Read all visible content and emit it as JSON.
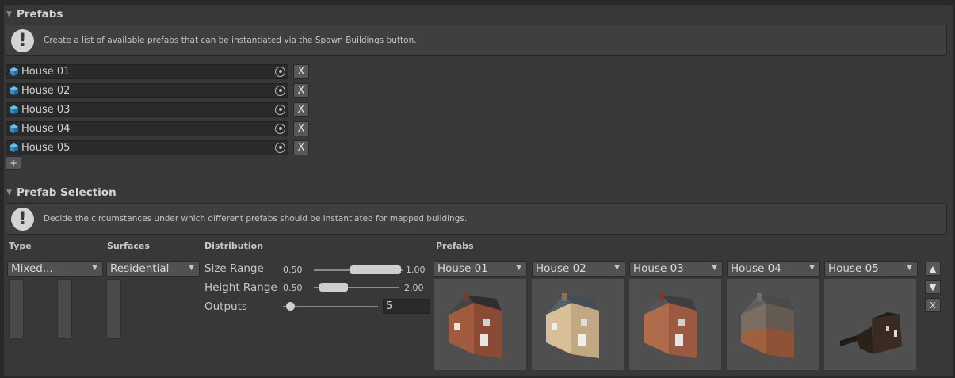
{
  "prefabs_section": {
    "title": "Prefabs",
    "help_text": "Create a list of available prefabs that can be instantiated via the Spawn Buildings button.",
    "items": [
      {
        "label": "House 01",
        "remove": "X"
      },
      {
        "label": "House 02",
        "remove": "X"
      },
      {
        "label": "House 03",
        "remove": "X"
      },
      {
        "label": "House 04",
        "remove": "X"
      },
      {
        "label": "House 05",
        "remove": "X"
      }
    ],
    "add_label": "+"
  },
  "selection_section": {
    "title": "Prefab Selection",
    "help_text": "Decide the circumstances under which different prefabs should be instantiated for mapped buildings.",
    "columns": {
      "type": "Type",
      "surfaces": "Surfaces",
      "distribution": "Distribution",
      "prefabs": "Prefabs"
    },
    "type_value": "Mixed...",
    "surfaces_value": "Residential",
    "size_range": {
      "label": "Size Range",
      "min": "0.50",
      "max": "1.00",
      "low": 0.7,
      "high": 0.95
    },
    "height_range": {
      "label": "Height Range",
      "min": "0.50",
      "max": "2.00",
      "low": 0.55,
      "high": 0.75
    },
    "outputs": {
      "label": "Outputs",
      "value": "5",
      "slider_fraction": 0.1
    },
    "prefab_slots": [
      {
        "label": "House 01"
      },
      {
        "label": "House 02"
      },
      {
        "label": "House 03"
      },
      {
        "label": "House 04"
      },
      {
        "label": "House 05"
      }
    ],
    "buttons": {
      "up": "▲",
      "down": "▼",
      "remove": "X"
    }
  },
  "icons": {
    "fold": "fold-triangle-icon",
    "help": "exclamation-icon",
    "prefab": "prefab-cube-icon",
    "picker": "object-picker-icon"
  },
  "colors": {
    "background": "#383838",
    "field": "#2a2a2a",
    "button": "#585858",
    "prefab_icon": "#4ba3d9"
  }
}
